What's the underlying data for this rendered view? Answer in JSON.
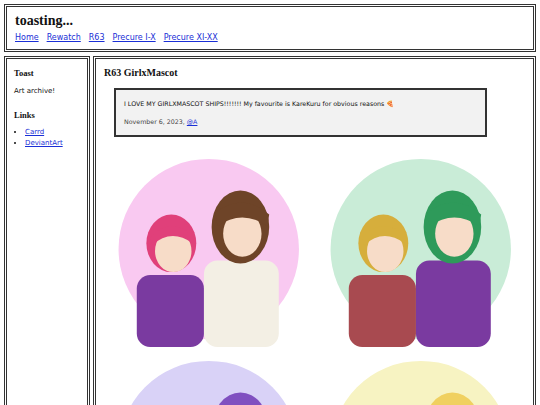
{
  "site": {
    "title": "toasting..."
  },
  "nav": [
    {
      "label": "Home"
    },
    {
      "label": "Rewatch"
    },
    {
      "label": "R63"
    },
    {
      "label": "Precure I-X"
    },
    {
      "label": "Precure XI-XX"
    }
  ],
  "sidebar": {
    "heading": "Toast",
    "tagline": "Art archive!",
    "links_heading": "Links",
    "links": [
      "Carrd",
      "DeviantArt"
    ]
  },
  "post": {
    "title": "R63 GirlxMascot",
    "text": "I LOVE MY GIRLXMASCOT SHIPS!!!!!!! My favourite is KareKuru for obvious reasons 🍕",
    "date": "November 6, 2023,",
    "author": "@A"
  },
  "artwork": [
    {
      "color": "#f9c9f1"
    },
    {
      "color": "#c9ecd7"
    },
    {
      "color": "#d9d2f7"
    },
    {
      "color": "#f7f3c2"
    }
  ]
}
